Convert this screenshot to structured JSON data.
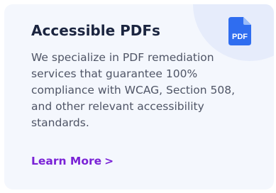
{
  "card": {
    "title": "Accessible PDFs",
    "description": "We specialize in PDF remediation services that guarantee 100% compliance with WCAG, Section 508, and other relevant accessibility standards.",
    "link_label": "Learn More",
    "link_chevron": ">",
    "icon": {
      "name": "pdf-file-icon",
      "text": "PDF",
      "color": "#2f6df0"
    }
  },
  "colors": {
    "card_background": "#f4f7fd",
    "corner_accent": "#e6ecfb",
    "title": "#1b2540",
    "body_text": "#4f5566",
    "link": "#7a22d6"
  }
}
